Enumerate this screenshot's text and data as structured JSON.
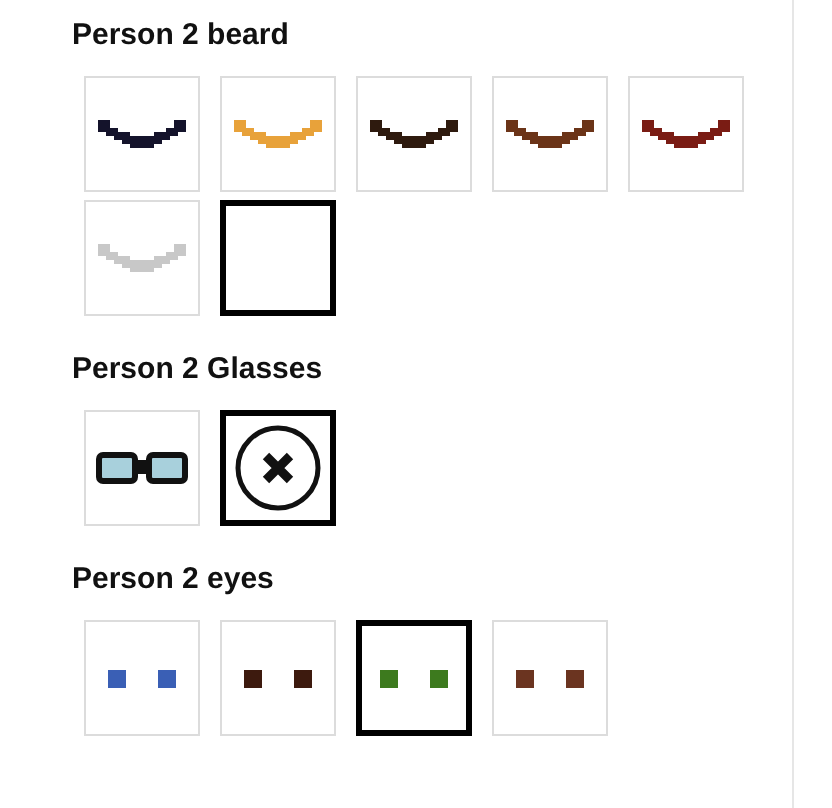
{
  "sections": [
    {
      "title": "Person 2 beard",
      "options": [
        {
          "kind": "beard",
          "color": "#14132b",
          "selected": false
        },
        {
          "kind": "beard",
          "color": "#e8a23a",
          "selected": false
        },
        {
          "kind": "beard",
          "color": "#2e1a0e",
          "selected": false
        },
        {
          "kind": "beard",
          "color": "#6b3418",
          "selected": false
        },
        {
          "kind": "beard",
          "color": "#7a1c14",
          "selected": false
        },
        {
          "kind": "beard",
          "color": "#c8c8c8",
          "selected": false
        },
        {
          "kind": "blank",
          "selected": true
        }
      ]
    },
    {
      "title": "Person 2 Glasses",
      "options": [
        {
          "kind": "glasses",
          "selected": false
        },
        {
          "kind": "none",
          "selected": true
        }
      ]
    },
    {
      "title": "Person 2 eyes",
      "options": [
        {
          "kind": "eyes",
          "color": "#3a5fb5",
          "selected": false
        },
        {
          "kind": "eyes",
          "color": "#3d1a0e",
          "selected": false
        },
        {
          "kind": "eyes",
          "color": "#3d7a1e",
          "selected": true
        },
        {
          "kind": "eyes",
          "color": "#6b3420",
          "selected": false
        }
      ]
    }
  ]
}
